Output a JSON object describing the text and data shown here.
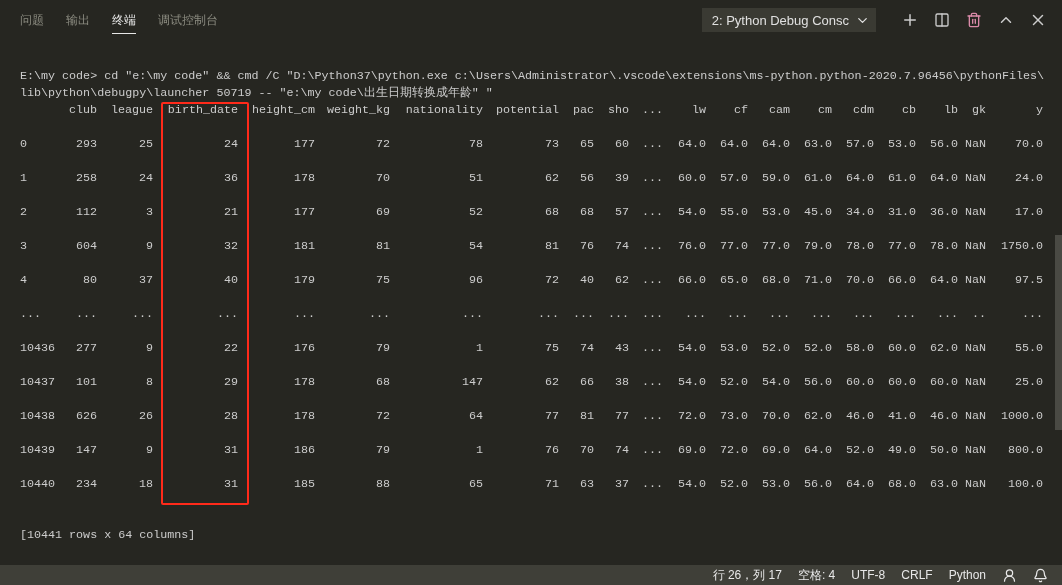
{
  "panel": {
    "tabs": [
      {
        "label": "问题",
        "selected": false
      },
      {
        "label": "输出",
        "selected": false
      },
      {
        "label": "终端",
        "selected": true
      },
      {
        "label": "调试控制台",
        "selected": false
      }
    ],
    "terminal_selector": "2: Python Debug Consc"
  },
  "terminal": {
    "command_lines": [
      "E:\\my code> cd \"e:\\my code\" && cmd /C \"D:\\Python37\\python.exe c:\\Users\\Administrator\\.vscode\\extensions\\ms-python.python-2020.7.96456\\pythonFiles\\",
      "lib\\python\\debugpy\\launcher 50719 -- \"e:\\my code\\出生日期转换成年龄\" \""
    ],
    "table": {
      "columns": [
        {
          "label": "club",
          "highlighted": false
        },
        {
          "label": "league",
          "highlighted": false
        },
        {
          "label": "birth_date",
          "highlighted": true
        },
        {
          "label": "height_cm",
          "highlighted": false
        },
        {
          "label": "weight_kg",
          "highlighted": false
        },
        {
          "label": "nationality",
          "highlighted": false
        },
        {
          "label": "potential",
          "highlighted": false
        },
        {
          "label": "pac",
          "highlighted": false
        },
        {
          "label": "sho",
          "highlighted": false
        },
        {
          "label": "...",
          "highlighted": false
        },
        {
          "label": "lw",
          "highlighted": false
        },
        {
          "label": "cf",
          "highlighted": false
        },
        {
          "label": "cam",
          "highlighted": false
        },
        {
          "label": "cm",
          "highlighted": false
        },
        {
          "label": "cdm",
          "highlighted": false
        },
        {
          "label": "cb",
          "highlighted": false
        },
        {
          "label": "lb",
          "highlighted": false
        },
        {
          "label": "gk",
          "highlighted": false
        },
        {
          "label": "y",
          "highlighted": false
        }
      ],
      "rows": [
        {
          "index": "0",
          "cells": [
            "293",
            "25",
            "24",
            "177",
            "72",
            "78",
            "73",
            "65",
            "60",
            "...",
            "64.0",
            "64.0",
            "64.0",
            "63.0",
            "57.0",
            "53.0",
            "56.0",
            "NaN",
            "70.0"
          ]
        },
        {
          "index": "1",
          "cells": [
            "258",
            "24",
            "36",
            "178",
            "70",
            "51",
            "62",
            "56",
            "39",
            "...",
            "60.0",
            "57.0",
            "59.0",
            "61.0",
            "64.0",
            "61.0",
            "64.0",
            "NaN",
            "24.0"
          ]
        },
        {
          "index": "2",
          "cells": [
            "112",
            "3",
            "21",
            "177",
            "69",
            "52",
            "68",
            "68",
            "57",
            "...",
            "54.0",
            "55.0",
            "53.0",
            "45.0",
            "34.0",
            "31.0",
            "36.0",
            "NaN",
            "17.0"
          ]
        },
        {
          "index": "3",
          "cells": [
            "604",
            "9",
            "32",
            "181",
            "81",
            "54",
            "81",
            "76",
            "74",
            "...",
            "76.0",
            "77.0",
            "77.0",
            "79.0",
            "78.0",
            "77.0",
            "78.0",
            "NaN",
            "1750.0"
          ]
        },
        {
          "index": "4",
          "cells": [
            "80",
            "37",
            "40",
            "179",
            "75",
            "96",
            "72",
            "40",
            "62",
            "...",
            "66.0",
            "65.0",
            "68.0",
            "71.0",
            "70.0",
            "66.0",
            "64.0",
            "NaN",
            "97.5"
          ]
        },
        {
          "index": "...",
          "cells": [
            "...",
            "...",
            "...",
            "...",
            "...",
            "...",
            "...",
            "...",
            "...",
            "...",
            "...",
            "...",
            "...",
            "...",
            "...",
            "...",
            "...",
            "..",
            "..."
          ]
        },
        {
          "index": "10436",
          "cells": [
            "277",
            "9",
            "22",
            "176",
            "79",
            "1",
            "75",
            "74",
            "43",
            "...",
            "54.0",
            "53.0",
            "52.0",
            "52.0",
            "58.0",
            "60.0",
            "62.0",
            "NaN",
            "55.0"
          ]
        },
        {
          "index": "10437",
          "cells": [
            "101",
            "8",
            "29",
            "178",
            "68",
            "147",
            "62",
            "66",
            "38",
            "...",
            "54.0",
            "52.0",
            "54.0",
            "56.0",
            "60.0",
            "60.0",
            "60.0",
            "NaN",
            "25.0"
          ]
        },
        {
          "index": "10438",
          "cells": [
            "626",
            "26",
            "28",
            "178",
            "72",
            "64",
            "77",
            "81",
            "77",
            "...",
            "72.0",
            "73.0",
            "70.0",
            "62.0",
            "46.0",
            "41.0",
            "46.0",
            "NaN",
            "1000.0"
          ]
        },
        {
          "index": "10439",
          "cells": [
            "147",
            "9",
            "31",
            "186",
            "79",
            "1",
            "76",
            "70",
            "74",
            "...",
            "69.0",
            "72.0",
            "69.0",
            "64.0",
            "52.0",
            "49.0",
            "50.0",
            "NaN",
            "800.0"
          ]
        },
        {
          "index": "10440",
          "cells": [
            "234",
            "18",
            "31",
            "185",
            "88",
            "65",
            "71",
            "63",
            "37",
            "...",
            "54.0",
            "52.0",
            "53.0",
            "56.0",
            "64.0",
            "68.0",
            "63.0",
            "NaN",
            "100.0"
          ]
        }
      ]
    },
    "summary": "[10441 rows x 64 columns]"
  },
  "status_bar": {
    "items": [
      "行 26，列 17",
      "空格: 4",
      "UTF-8",
      "CRLF",
      "Python"
    ]
  }
}
